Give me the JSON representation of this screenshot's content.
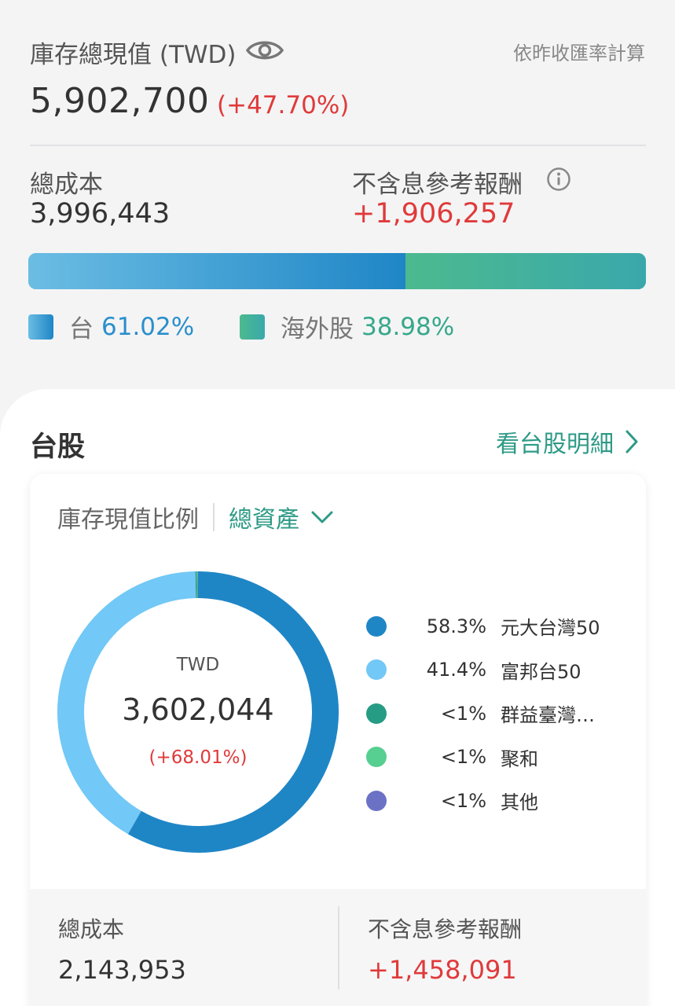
{
  "summary": {
    "total_value_label": "庫存總現值 (TWD)",
    "rate_note": "依昨收匯率計算",
    "total_value": "5,902,700",
    "total_change_pct": "(+47.70%)",
    "cost_label": "總成本",
    "cost_value": "3,996,443",
    "return_label": "不含息參考報酬",
    "return_value": "+1,906,257"
  },
  "allocation": {
    "tw_fraction": 0.6102,
    "tw_name": "台",
    "tw_pct": "61.02%",
    "overseas_name": "海外股",
    "overseas_pct": "38.98%"
  },
  "tw_section": {
    "title": "台股",
    "detail_link": "看台股明細",
    "card_label": "庫存現值比例",
    "dropdown_value": "總資產",
    "center_currency": "TWD",
    "center_value": "3,602,044",
    "center_change": "(+68.01%)",
    "holdings": [
      {
        "pct_label": "58.3%",
        "name": "元大台灣50",
        "value": 58.3,
        "color": "#1f86c6"
      },
      {
        "pct_label": "41.4%",
        "name": "富邦台50",
        "value": 41.4,
        "color": "#72c8f6"
      },
      {
        "pct_label": "<1%",
        "name": "群益臺灣…",
        "value": 0.15,
        "color": "#269c84"
      },
      {
        "pct_label": "<1%",
        "name": "聚和",
        "value": 0.1,
        "color": "#56cf91"
      },
      {
        "pct_label": "<1%",
        "name": "其他",
        "value": 0.05,
        "color": "#6b72c6"
      }
    ],
    "foot_cost_label": "總成本",
    "foot_cost_value": "2,143,953",
    "foot_return_label": "不含息參考報酬",
    "foot_return_value": "+1,458,091"
  },
  "colors": {
    "positive": "#e03a3a",
    "accent_green": "#2e9a86",
    "tw_blue": "#1f86c6"
  }
}
